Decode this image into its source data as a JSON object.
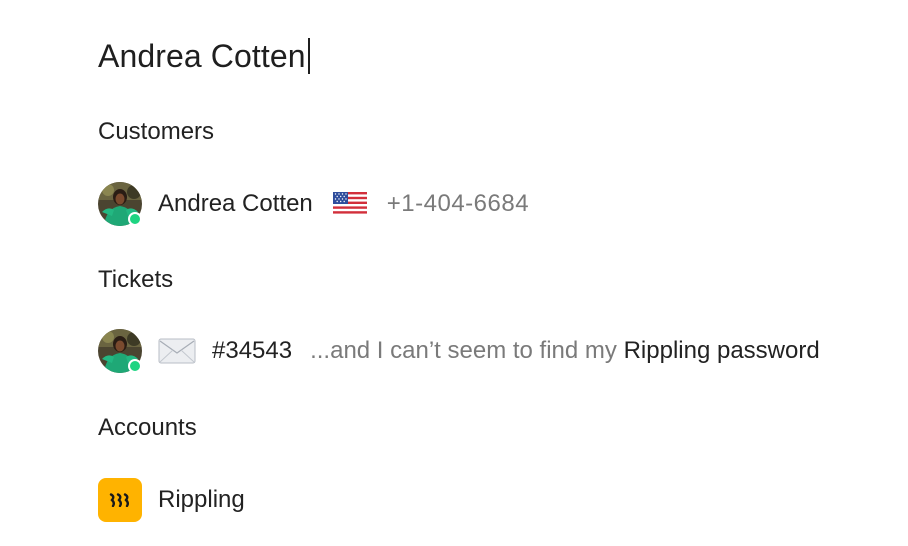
{
  "search": {
    "query": "Andrea Cotten"
  },
  "customers": {
    "title": "Customers",
    "items": [
      {
        "name": "Andrea Cotten",
        "flag": "us-flag",
        "phone": "+1-404-6684",
        "status": "online"
      }
    ]
  },
  "tickets": {
    "title": "Tickets",
    "items": [
      {
        "channel": "email-icon",
        "id": "#34543",
        "snippet_prefix": "...and I can’t seem to find my ",
        "snippet_match": "Rippling password",
        "status": "online"
      }
    ]
  },
  "accounts": {
    "title": "Accounts",
    "items": [
      {
        "name": "Rippling",
        "logo_color": "#ffb300"
      }
    ]
  },
  "colors": {
    "presence": "#1ed482",
    "muted_text": "#7a7a7a",
    "primary_text": "#222222"
  }
}
